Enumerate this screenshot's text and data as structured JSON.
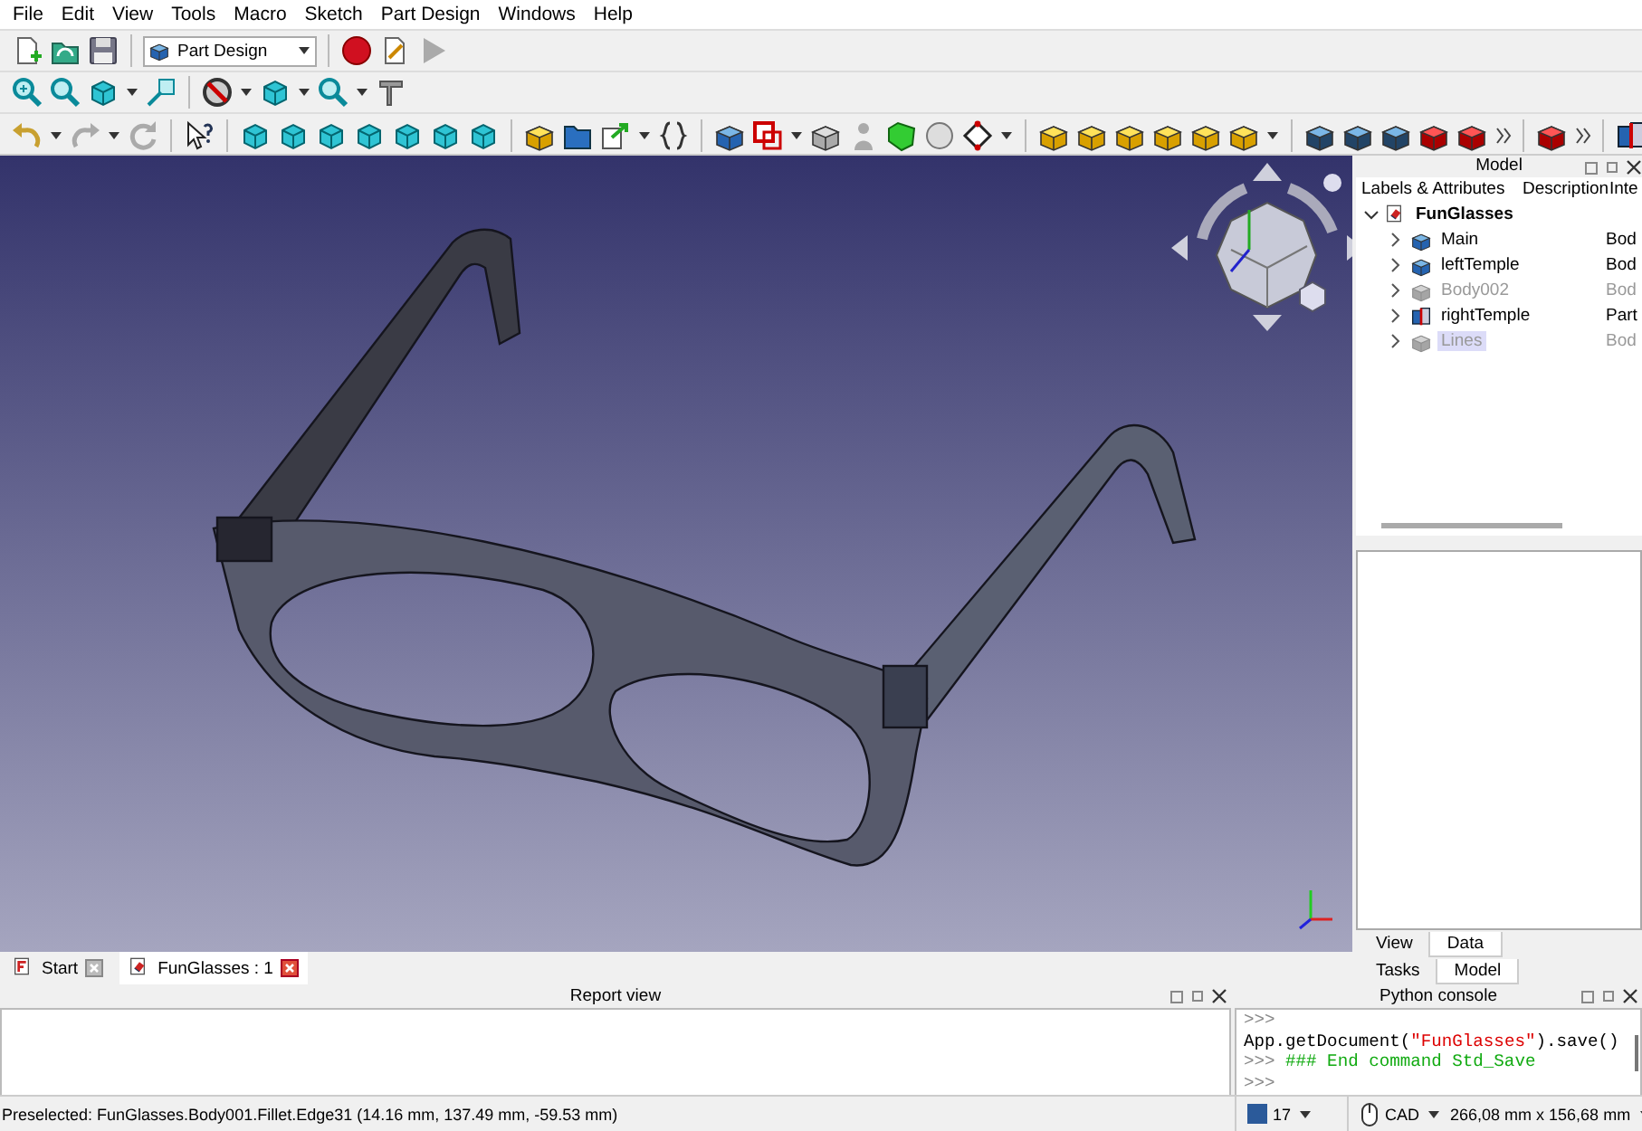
{
  "menu_bar": [
    "File",
    "Edit",
    "View",
    "Tools",
    "Macro",
    "Sketch",
    "Part Design",
    "Windows",
    "Help"
  ],
  "workbench_selector": {
    "value": "Part Design"
  },
  "model_panel": {
    "title": "Model",
    "columns": [
      "Labels & Attributes",
      "Description",
      "Inte"
    ],
    "tree": [
      {
        "label": "FunGlasses",
        "kind": "document",
        "expanded": true,
        "selected": false,
        "visible": true,
        "children": [
          {
            "label": "Main",
            "kind": "body",
            "expanded": false,
            "selected": false,
            "visible": true,
            "column_3": "Bod"
          },
          {
            "label": "leftTemple",
            "kind": "body",
            "expanded": false,
            "selected": false,
            "visible": true,
            "column_3": "Bod"
          },
          {
            "label": "Body002",
            "kind": "body",
            "expanded": false,
            "selected": false,
            "visible": false,
            "column_3": "Bod"
          },
          {
            "label": "rightTemple",
            "kind": "part",
            "expanded": false,
            "selected": false,
            "visible": true,
            "column_3": "Part"
          },
          {
            "label": "Lines",
            "kind": "body",
            "expanded": false,
            "selected": true,
            "visible": false,
            "column_3": "Bod"
          }
        ]
      }
    ]
  },
  "property_tabs": [
    {
      "label": "View",
      "selected": false
    },
    {
      "label": "Data",
      "selected": true
    }
  ],
  "panel_tabs": [
    {
      "label": "Tasks",
      "selected": false
    },
    {
      "label": "Model",
      "selected": true
    }
  ],
  "document_tabs": [
    {
      "label": "Start",
      "kind": "start",
      "selected": false
    },
    {
      "label": "FunGlasses : 1",
      "kind": "document",
      "selected": true
    }
  ],
  "report_view": {
    "title": "Report view"
  },
  "python_console": {
    "title": "Python console",
    "lines": [
      {
        "segments": [
          {
            "kind": "prompt",
            "text": ">>>"
          }
        ]
      },
      {
        "segments": [
          {
            "kind": "code",
            "text": "App.getDocument("
          },
          {
            "kind": "string",
            "text": "\"FunGlasses\""
          },
          {
            "kind": "code",
            "text": ").save()"
          }
        ]
      },
      {
        "segments": [
          {
            "kind": "prompt",
            "text": ">>> "
          },
          {
            "kind": "comment",
            "text": "### End command Std_Save"
          }
        ]
      },
      {
        "segments": [
          {
            "kind": "prompt",
            "text": ">>>"
          }
        ]
      }
    ]
  },
  "status_bar": {
    "message": "Preselected: FunGlasses.Body001.Fillet.Edge31 (14.16 mm, 137.49 mm, -59.53 mm)",
    "units": "17",
    "navigation_style": "CAD",
    "dimensions": "266,08 mm x 156,68 mm"
  }
}
